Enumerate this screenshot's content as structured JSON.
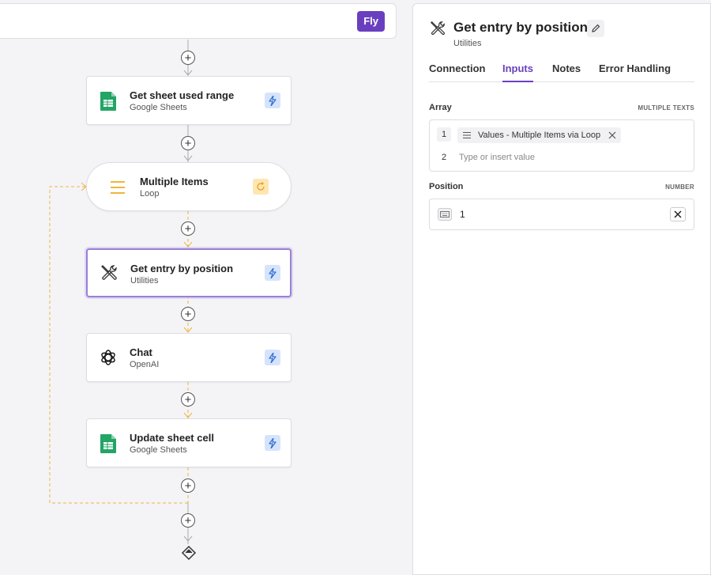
{
  "toolbar": {
    "fly_label": "Fly"
  },
  "flow": {
    "nodes": [
      {
        "id": "sheet-used-range",
        "title": "Get sheet used range",
        "subtitle": "Google Sheets",
        "icon": "google-sheets-icon"
      },
      {
        "id": "multiple-items",
        "title": "Multiple Items",
        "subtitle": "Loop",
        "icon": "list-icon"
      },
      {
        "id": "get-entry",
        "title": "Get entry by position",
        "subtitle": "Utilities",
        "icon": "tools-icon",
        "active": true
      },
      {
        "id": "chat",
        "title": "Chat",
        "subtitle": "OpenAI",
        "icon": "openai-icon"
      },
      {
        "id": "update-cell",
        "title": "Update sheet cell",
        "subtitle": "Google Sheets",
        "icon": "google-sheets-icon"
      }
    ]
  },
  "panel": {
    "title": "Get entry by position",
    "subtitle": "Utilities",
    "tabs": [
      {
        "label": "Connection"
      },
      {
        "label": "Inputs",
        "active": true
      },
      {
        "label": "Notes"
      },
      {
        "label": "Error Handling"
      }
    ],
    "array": {
      "label": "Array",
      "type": "MULTIPLE TEXTS",
      "rows": [
        {
          "num": "1",
          "chip": "Values - Multiple Items via Loop"
        },
        {
          "num": "2",
          "placeholder": "Type or insert value"
        }
      ]
    },
    "position": {
      "label": "Position",
      "type": "NUMBER",
      "value": "1"
    }
  },
  "colors": {
    "accent": "#6a3fbf",
    "loop_line": "#f0b53c",
    "trigger_badge": "#d6e4fb",
    "sheets_green": "#23a566"
  }
}
